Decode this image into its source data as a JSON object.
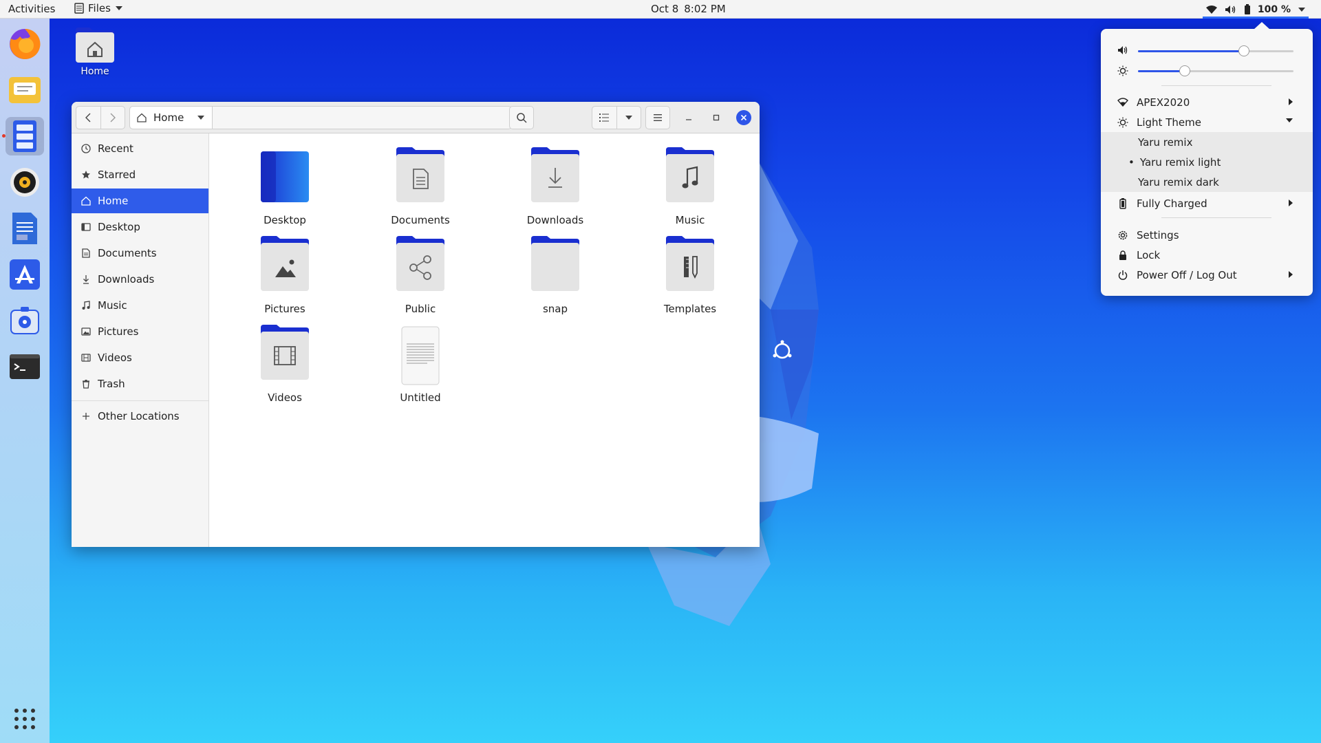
{
  "topbar": {
    "activities": "Activities",
    "app_name": "Files",
    "date": "Oct 8",
    "time": "8:02 PM",
    "battery_percent": "100 %"
  },
  "dock": {
    "items": [
      "firefox",
      "mail",
      "files",
      "rhythmbox",
      "libreoffice-writer",
      "app-store",
      "help",
      "terminal",
      "show-applications"
    ]
  },
  "desktop": {
    "home_label": "Home"
  },
  "window": {
    "path_label": "Home",
    "sidebar": {
      "recent": "Recent",
      "starred": "Starred",
      "home": "Home",
      "desktop": "Desktop",
      "documents": "Documents",
      "downloads": "Downloads",
      "music": "Music",
      "pictures": "Pictures",
      "videos": "Videos",
      "trash": "Trash",
      "other_locations": "Other Locations"
    },
    "files": {
      "desktop": "Desktop",
      "documents": "Documents",
      "downloads": "Downloads",
      "music": "Music",
      "pictures": "Pictures",
      "public": "Public",
      "snap": "snap",
      "templates": "Templates",
      "videos": "Videos",
      "untitled": "Untitled"
    }
  },
  "system_menu": {
    "volume_level": 0.68,
    "brightness_level": 0.3,
    "wifi_name": "APEX2020",
    "theme_label": "Light Theme",
    "theme_options": [
      "Yaru remix",
      "Yaru remix light",
      "Yaru remix dark"
    ],
    "theme_selected_marker": "•",
    "battery_status": "Fully Charged",
    "settings": "Settings",
    "lock": "Lock",
    "power": "Power Off / Log Out"
  },
  "colors": {
    "accent": "#2e55e8",
    "folder_blue": "#1a2fd0",
    "topbar": "#f4f4f4"
  }
}
